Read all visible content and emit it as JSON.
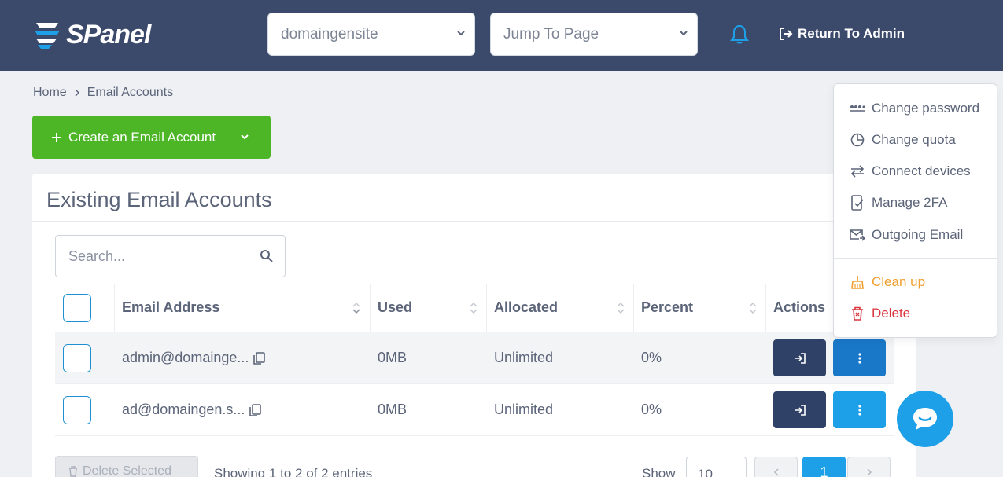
{
  "header": {
    "logo_text": "SPanel",
    "domain_select": "domaingensite",
    "jump_select": "Jump To Page",
    "return_label": "Return To Admin"
  },
  "breadcrumb": {
    "home": "Home",
    "current": "Email Accounts"
  },
  "create_button": "Create an Email Account",
  "card": {
    "title": "Existing Email Accounts"
  },
  "search": {
    "placeholder": "Search..."
  },
  "table": {
    "headers": {
      "email": "Email Address",
      "used": "Used",
      "allocated": "Allocated",
      "percent": "Percent",
      "actions": "Actions"
    },
    "rows": [
      {
        "email": "admin@domainge...",
        "used": "0MB",
        "allocated": "Unlimited",
        "percent": "0%"
      },
      {
        "email": "ad@domaingen.s...",
        "used": "0MB",
        "allocated": "Unlimited",
        "percent": "0%"
      }
    ]
  },
  "footer": {
    "delete_selected": "Delete Selected",
    "showing": "Showing 1 to 2 of 2 entries",
    "show_label": "Show",
    "page_length": "10",
    "current_page": "1"
  },
  "dropdown": {
    "items": [
      {
        "label": "Change password",
        "icon": "password-icon"
      },
      {
        "label": "Change quota",
        "icon": "pie-chart-icon"
      },
      {
        "label": "Connect devices",
        "icon": "arrows-swap-icon"
      },
      {
        "label": "Manage 2FA",
        "icon": "document-check-icon"
      },
      {
        "label": "Outgoing Email",
        "icon": "mail-send-icon"
      },
      {
        "label": "Clean up",
        "icon": "broom-icon"
      },
      {
        "label": "Delete",
        "icon": "trash-icon"
      }
    ]
  },
  "colors": {
    "topbar": "#3b4a6b",
    "create_green": "#4db626",
    "accent_blue": "#1ea0e8",
    "warn": "#f0a030",
    "danger": "#d9363e"
  }
}
